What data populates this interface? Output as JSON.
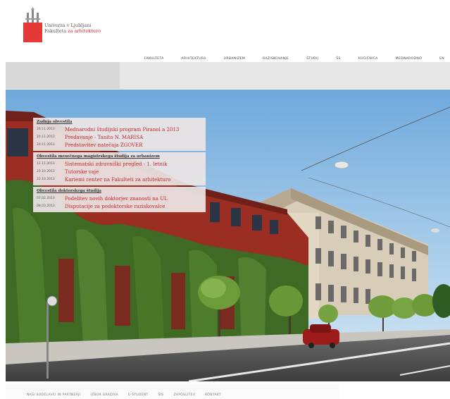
{
  "header": {
    "logo_line1": "Univerza v Ljubljani",
    "logo_line2": "Fakulteta",
    "logo_line2_accent": "za arhitekturo"
  },
  "nav": {
    "items": [
      "FAKULTETA",
      "ARHITEKTURA",
      "URBANIZEM",
      "RAZISKOVANJE",
      "ŠTUDIJ",
      "ŠS",
      "KUĆIČNICA",
      "MEDNARODNO",
      "EN"
    ]
  },
  "news": {
    "sections": [
      {
        "heading": "Zadnja obvestila",
        "items": [
          {
            "date": "20.11.2013",
            "title": "Mednarodni študijski program Piranol a 2013"
          },
          {
            "date": "20.11.2013",
            "title": "Predavanje - Tanito N. MARISA"
          },
          {
            "date": "20.11.2013",
            "title": "Predstavitev natečaja ZGOVER"
          }
        ]
      },
      {
        "heading": "Obvestila mesečnega magistrskega študija za urbanizem",
        "items": [
          {
            "date": "11.11.2013",
            "title": "Sistematski zdravniški pregled - 1. letnik"
          },
          {
            "date": "25.10.2013",
            "title": "Tutorske vaje"
          },
          {
            "date": "22.10.2013",
            "title": "Kariemi center na Fakulteti za arhitekturo"
          }
        ]
      },
      {
        "heading": "Obvestila doktorskega študija",
        "items": [
          {
            "date": "07.02.2013",
            "title": "Podelitev novih doktorjev znanosti na UL"
          },
          {
            "date": "08.03.2013",
            "title": "Disputacije za podoktorske raziskovalce"
          }
        ]
      }
    ]
  },
  "footer": {
    "links": [
      "NAŠI SODELAVCI IN PARTNERJI",
      "IZBOR GRADIVA",
      "E-ŠTUDENT",
      "ŠIS",
      "ZAPOSLITEV",
      "KONTAKT"
    ]
  },
  "colors": {
    "accent": "#d32f2f",
    "news_title": "#c62828"
  }
}
